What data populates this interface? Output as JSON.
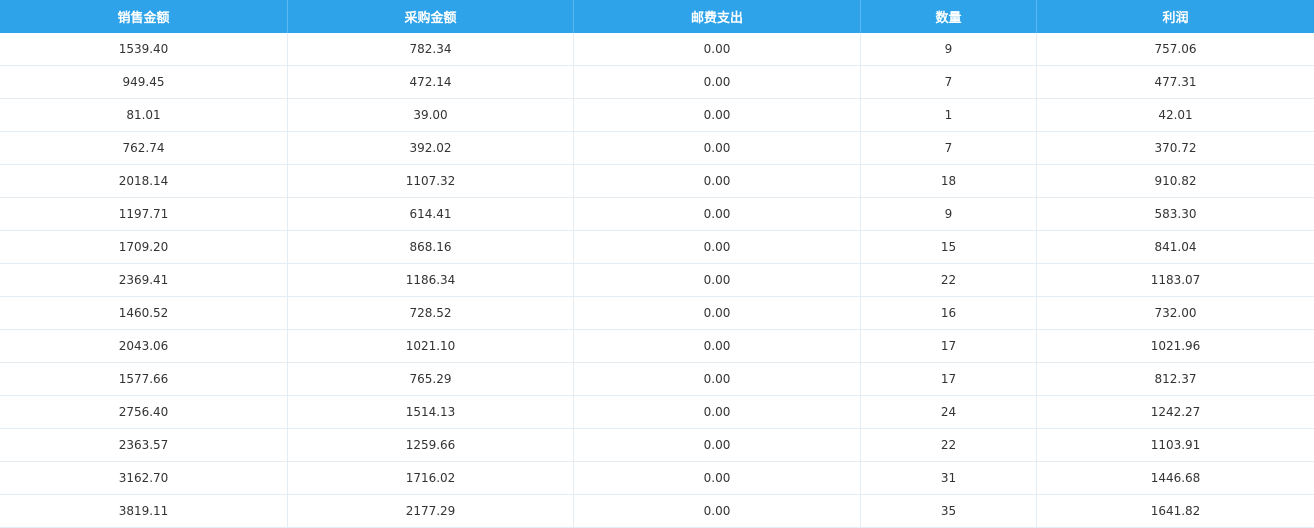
{
  "table": {
    "headers": [
      "销售金额",
      "采购金额",
      "邮费支出",
      "数量",
      "利润"
    ],
    "rows": [
      [
        "1539.40",
        "782.34",
        "0.00",
        "9",
        "757.06"
      ],
      [
        "949.45",
        "472.14",
        "0.00",
        "7",
        "477.31"
      ],
      [
        "81.01",
        "39.00",
        "0.00",
        "1",
        "42.01"
      ],
      [
        "762.74",
        "392.02",
        "0.00",
        "7",
        "370.72"
      ],
      [
        "2018.14",
        "1107.32",
        "0.00",
        "18",
        "910.82"
      ],
      [
        "1197.71",
        "614.41",
        "0.00",
        "9",
        "583.30"
      ],
      [
        "1709.20",
        "868.16",
        "0.00",
        "15",
        "841.04"
      ],
      [
        "2369.41",
        "1186.34",
        "0.00",
        "22",
        "1183.07"
      ],
      [
        "1460.52",
        "728.52",
        "0.00",
        "16",
        "732.00"
      ],
      [
        "2043.06",
        "1021.10",
        "0.00",
        "17",
        "1021.96"
      ],
      [
        "1577.66",
        "765.29",
        "0.00",
        "17",
        "812.37"
      ],
      [
        "2756.40",
        "1514.13",
        "0.00",
        "24",
        "1242.27"
      ],
      [
        "2363.57",
        "1259.66",
        "0.00",
        "22",
        "1103.91"
      ],
      [
        "3162.70",
        "1716.02",
        "0.00",
        "31",
        "1446.68"
      ],
      [
        "3819.11",
        "2177.29",
        "0.00",
        "35",
        "1641.82"
      ]
    ]
  },
  "colors": {
    "header_bg": "#2ea3ea",
    "header_text": "#ffffff",
    "grid_line": "#e4edf4",
    "cell_text": "#333333"
  }
}
